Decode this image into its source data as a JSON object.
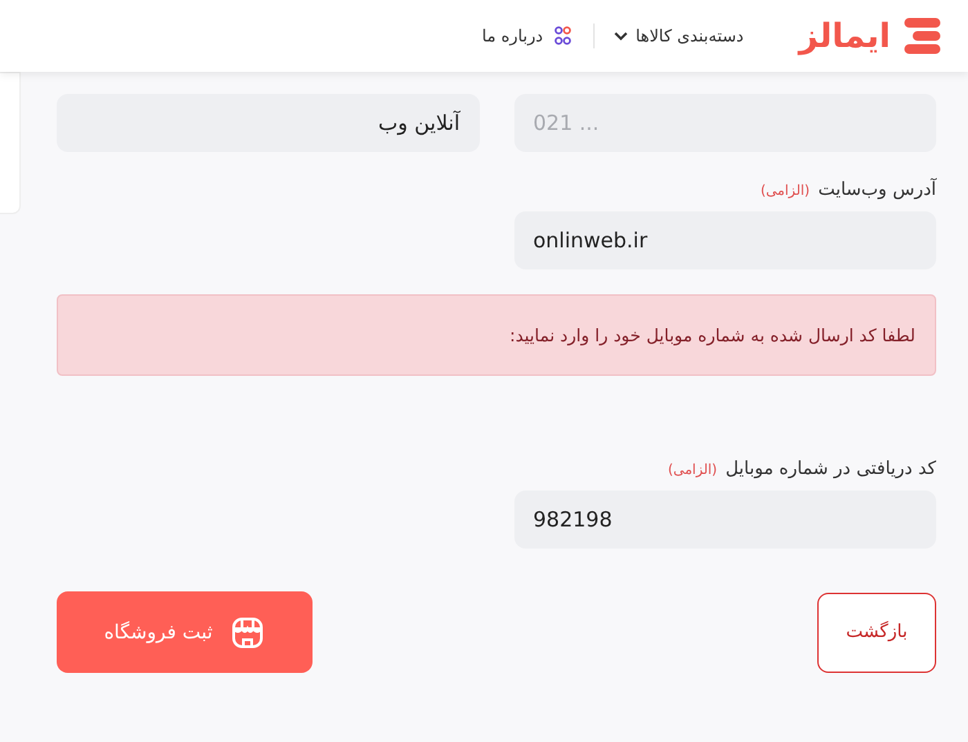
{
  "header": {
    "logo": "ایمالز",
    "nav": [
      {
        "label": "دسته‌بندی کالاها",
        "kind": "dropdown"
      },
      {
        "label": "درباره ما",
        "kind": "link"
      }
    ]
  },
  "fields_top": [
    {
      "placeholder": "021 ..."
    },
    {
      "value": "آنلاین وب"
    }
  ],
  "website": {
    "label": "آدرس وب‌سایت",
    "required": "(الزامی)",
    "value": "onlinweb.ir"
  },
  "alert": "لطفا کد ارسال شده به شماره موبایل خود را وارد نمایید:",
  "code": {
    "label": "کد دریافتی در شماره موبایل",
    "required": "(الزامی)",
    "value": "982198"
  },
  "buttons": {
    "back": "بازگشت",
    "submit": "ثبت فروشگاه"
  }
}
